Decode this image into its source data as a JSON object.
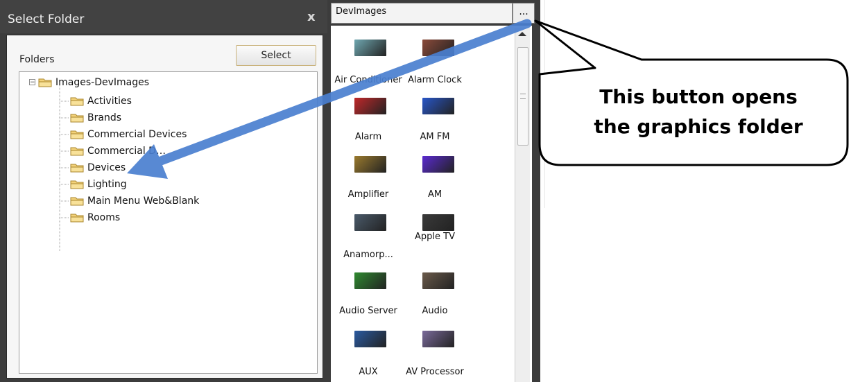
{
  "dialog": {
    "title": "Select Folder",
    "close_glyph": "x",
    "folders_label": "Folders",
    "select_button": "Select",
    "tree": {
      "root": "Images-DevImages",
      "expander": "−",
      "children": [
        "Activities",
        "Brands",
        "Commercial Devices",
        "Commercial D…",
        "Devices",
        "Lighting",
        "Main Menu Web&Blank",
        "Rooms"
      ]
    }
  },
  "panel": {
    "path": "DevImages",
    "browse_button": "...",
    "tiles": [
      {
        "label": "Air Conditioner",
        "color": "#6fa7b0",
        "icon": "air-conditioner-thumb"
      },
      {
        "label": "Alarm Clock",
        "color": "#8a4a3a",
        "icon": "alarm-clock-thumb"
      },
      {
        "label": "Alarm",
        "color": "#c0282a",
        "icon": "alarm-thumb"
      },
      {
        "label": "AM FM",
        "color": "#2856c8",
        "icon": "am-fm-thumb"
      },
      {
        "label": "Amplifier",
        "color": "#9a7a2e",
        "icon": "amplifier-thumb"
      },
      {
        "label": "AM",
        "color": "#5a2ad0",
        "icon": "am-thumb"
      },
      {
        "label": "Anamorp...",
        "color": "#4a5a6a",
        "icon": "anamorphic-thumb"
      },
      {
        "label": "Apple TV",
        "color": "#3a3a3a",
        "icon": "apple-tv-thumb"
      },
      {
        "label": "Audio Server",
        "color": "#2f8a30",
        "icon": "audio-server-thumb"
      },
      {
        "label": "Audio",
        "color": "#6a5a4a",
        "icon": "audio-thumb"
      },
      {
        "label": "AUX",
        "color": "#2a5aa0",
        "icon": "aux-thumb"
      },
      {
        "label": "AV Processor",
        "color": "#7a6a9a",
        "icon": "av-processor-thumb"
      }
    ]
  },
  "callout": {
    "line1": "This button opens",
    "line2": "the graphics folder"
  },
  "colors": {
    "dialog_bg": "#3c3c3c",
    "arrow": "#4a7fd0",
    "select_border": "#c9b27a"
  }
}
